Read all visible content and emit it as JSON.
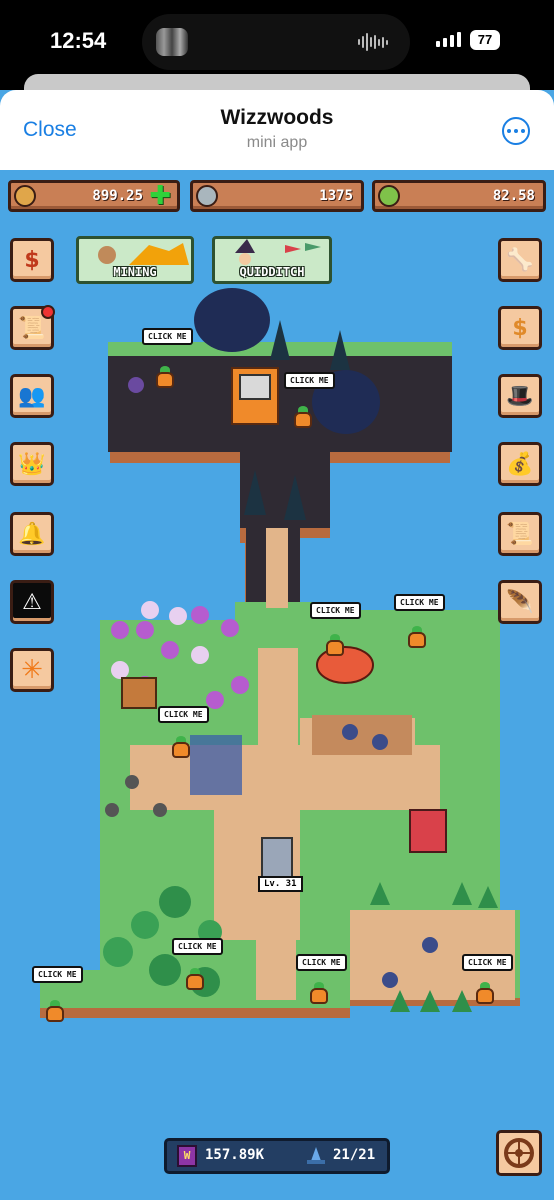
{
  "status": {
    "time": "12:54",
    "battery": "77"
  },
  "header": {
    "close_label": "Close",
    "title": "Wizzwoods",
    "subtitle": "mini app"
  },
  "resources": {
    "gold": {
      "value": "899.25",
      "icon": "gold-coin-icon",
      "color": "#e0a64a"
    },
    "silver": {
      "value": "1375",
      "icon": "silver-coin-icon",
      "color": "#a9b6bd"
    },
    "green": {
      "value": "82.58",
      "icon": "green-coin-icon",
      "color": "#7fc24a"
    }
  },
  "top_buttons": {
    "mining": "MINING",
    "quidditch": "QUIDDITCH"
  },
  "left_menu": [
    "shop-cart-icon",
    "scroll-quest-icon",
    "friends-icon",
    "crown-icon",
    "bells-gift-icon",
    "warning-triangle-icon",
    "orange-star-icon"
  ],
  "right_menu": [
    "bone-icon",
    "dollar-coin-icon",
    "wizard-hat-icon",
    "loot-bag-icon",
    "map-scroll-icon",
    "feather-icon"
  ],
  "map": {
    "click_label": "CLICK ME",
    "statue_label": "Lv. 31"
  },
  "bottom": {
    "spellbook_letter": "W",
    "spellbook_value": "157.89K",
    "hat_value": "21/21"
  }
}
